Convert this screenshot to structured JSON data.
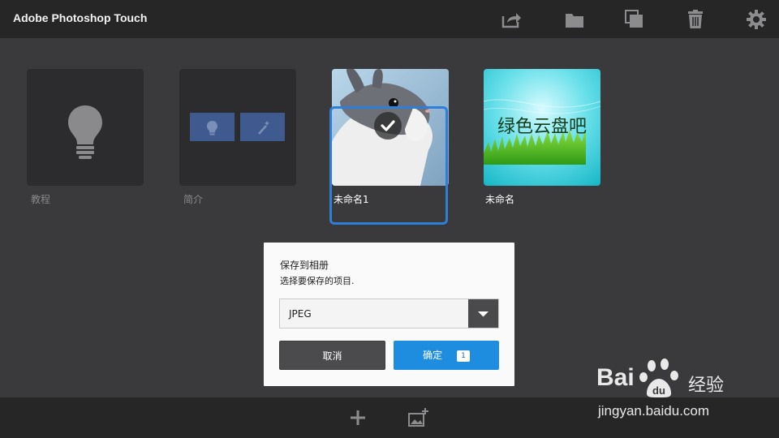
{
  "app": {
    "title": "Adobe Photoshop Touch"
  },
  "toolbar": {
    "icons": [
      "share-icon",
      "folder-icon",
      "duplicate-icon",
      "trash-icon",
      "gear-icon"
    ]
  },
  "projects": [
    {
      "label": "教程",
      "kind": "tutorial",
      "icon": "lightbulb-icon"
    },
    {
      "label": "简介",
      "kind": "intro",
      "icons": [
        "lightbulb-icon",
        "magic-wand-icon"
      ]
    },
    {
      "label": "未命名1",
      "kind": "image",
      "selected": true,
      "subject": "rabbit-photo"
    },
    {
      "label": "未命名",
      "kind": "image",
      "selected": false,
      "image_text": "绿色云盘吧"
    }
  ],
  "dialog": {
    "title": "保存到相册",
    "subtitle": "选择要保存的项目.",
    "format_value": "JPEG",
    "cancel_label": "取消",
    "ok_label": "确定",
    "ok_count": "1"
  },
  "bottombar": {
    "icons": [
      "add-icon",
      "add-image-icon"
    ]
  },
  "watermark": {
    "brand": "Bai",
    "brand_suffix": "经验",
    "url": "jingyan.baidu.com"
  },
  "colors": {
    "accent": "#1e8ddf",
    "selection": "#2f7fd9",
    "background": "#3a3a3c",
    "bar": "#262627"
  }
}
